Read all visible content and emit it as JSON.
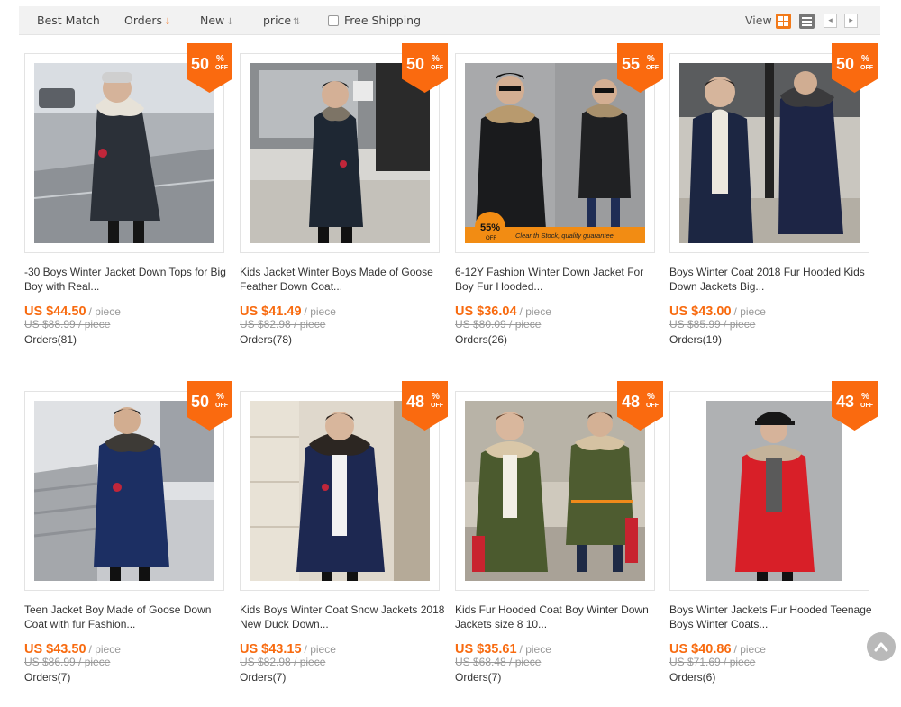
{
  "sort_bar": {
    "best_match": "Best Match",
    "orders": "Orders",
    "orders_arrow": "↓",
    "new": "New",
    "new_arrow": "↓",
    "price": "price",
    "price_arrow": "⇅",
    "free_shipping": "Free Shipping",
    "view_label": "View",
    "view_grid_icon": "grid-view-icon",
    "view_list_icon": "list-view-icon",
    "prev": "◂",
    "next": "▸"
  },
  "colors": {
    "accent": "#f86b10",
    "badge": "#fa6a0f"
  },
  "products": [
    {
      "discount": "50",
      "title": "-30 Boys Winter Jacket Down Tops for Big Boy with Real...",
      "price": "US $44.50",
      "unit": "/ piece",
      "old_price": "US $88.99 / piece",
      "orders": "Orders(81)"
    },
    {
      "discount": "50",
      "title": "Kids Jacket Winter Boys Made of Goose Feather Down Coat...",
      "price": "US $41.49",
      "unit": "/ piece",
      "old_price": "US $82.98 / piece",
      "orders": "Orders(78)"
    },
    {
      "discount": "55",
      "title": "6-12Y Fashion Winter Down Jacket For Boy Fur Hooded...",
      "price": "US $36.04",
      "unit": "/ piece",
      "old_price": "US $80.09 / piece",
      "orders": "Orders(26)"
    },
    {
      "discount": "50",
      "title": "Boys Winter Coat 2018 Fur Hooded Kids Down Jackets Big...",
      "price": "US $43.00",
      "unit": "/ piece",
      "old_price": "US $85.99 / piece",
      "orders": "Orders(19)"
    },
    {
      "discount": "50",
      "title": "Teen Jacket Boy Made of Goose Down Coat with fur Fashion...",
      "price": "US $43.50",
      "unit": "/ piece",
      "old_price": "US $86.99 / piece",
      "orders": "Orders(7)"
    },
    {
      "discount": "48",
      "title": "Kids Boys Winter Coat Snow Jackets 2018 New Duck Down...",
      "price": "US $43.15",
      "unit": "/ piece",
      "old_price": "US $82.98 / piece",
      "orders": "Orders(7)"
    },
    {
      "discount": "48",
      "title": "Kids Fur Hooded Coat Boy Winter Down Jackets size 8 10...",
      "price": "US $35.61",
      "unit": "/ piece",
      "old_price": "US $68.48 / piece",
      "orders": "Orders(7)"
    },
    {
      "discount": "43",
      "title": "Boys Winter Jackets Fur Hooded Teenage Boys Winter Coats...",
      "price": "US $40.86",
      "unit": "/ piece",
      "old_price": "US $71.69 / piece",
      "orders": "Orders(6)"
    }
  ],
  "badge_percent": "%",
  "badge_off": "OFF",
  "photo_overlay": {
    "badge": "55%",
    "off": "OFF",
    "caption": "Clear th Stock, quality guarantee"
  },
  "back_to_top_icon": "chevron-up-icon"
}
